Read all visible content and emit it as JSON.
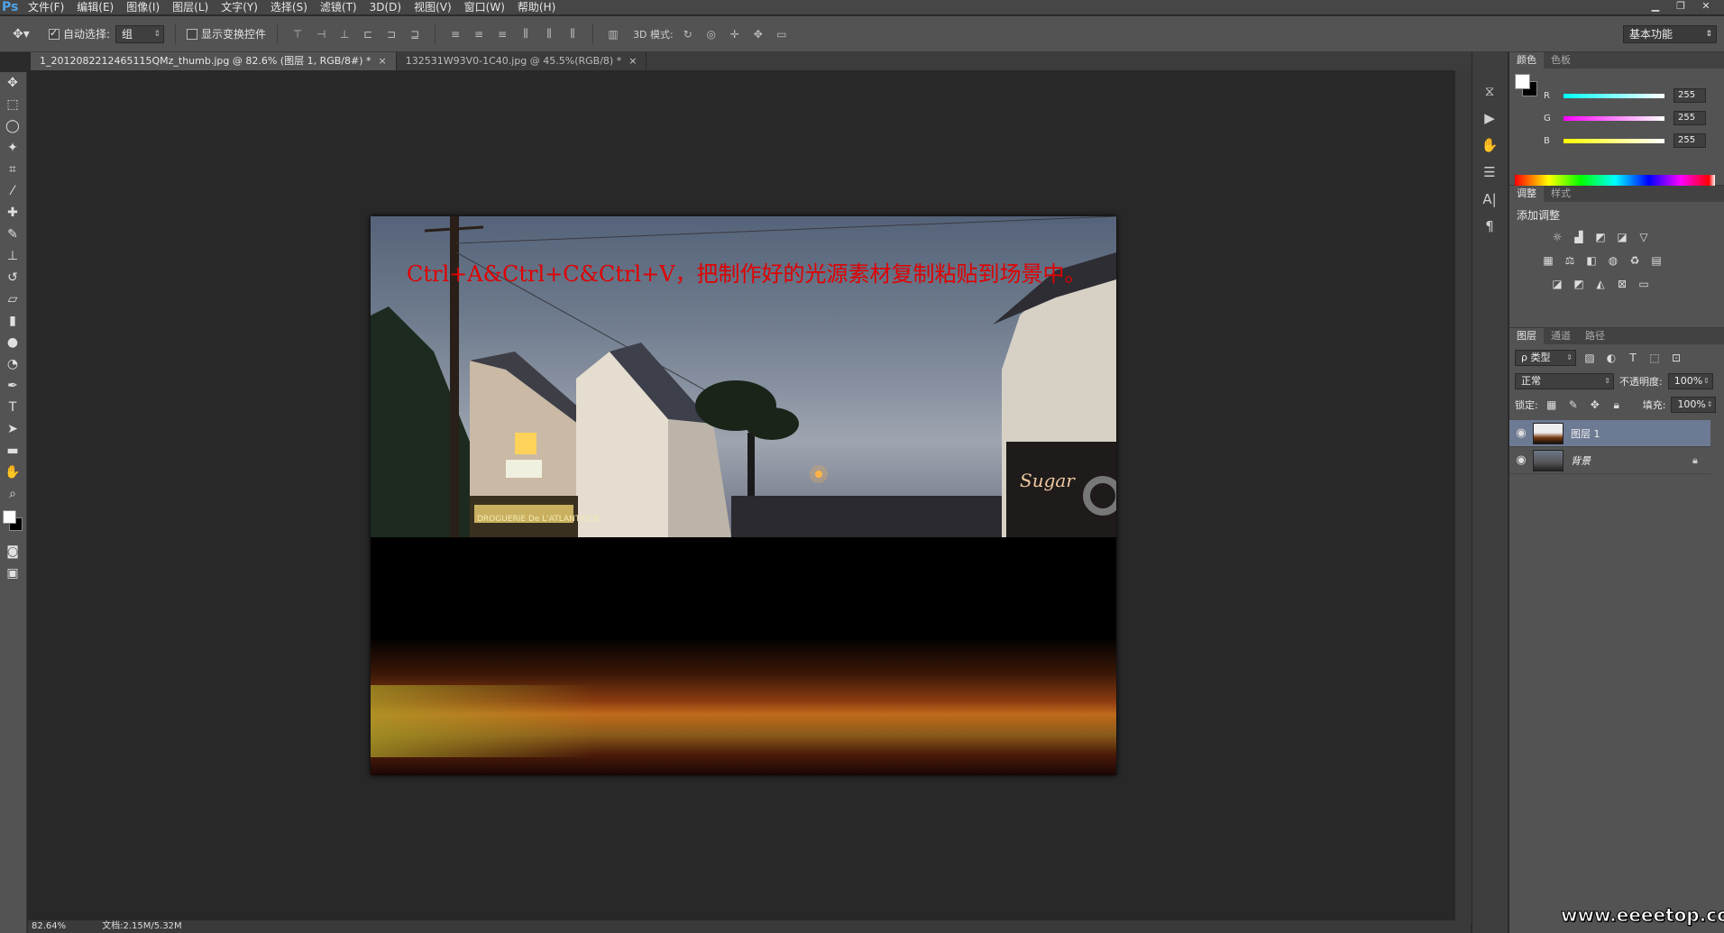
{
  "app": {
    "logo": "Ps"
  },
  "menu": [
    "文件(F)",
    "编辑(E)",
    "图像(I)",
    "图层(L)",
    "文字(Y)",
    "选择(S)",
    "滤镜(T)",
    "3D(D)",
    "视图(V)",
    "窗口(W)",
    "帮助(H)"
  ],
  "options": {
    "auto_select_label": "自动选择:",
    "auto_select_value": "组",
    "show_transform_label": "显示变换控件",
    "mode_label": "3D 模式:",
    "workspace": "基本功能"
  },
  "tabs": [
    {
      "label": "1_2012082212465115QMz_thumb.jpg @ 82.6% (图层 1, RGB/8#) *",
      "close": "×"
    },
    {
      "label": "132531W93V0-1C40.jpg @ 45.5%(RGB/8) *",
      "close": "×"
    }
  ],
  "canvas": {
    "caption": "Ctrl+A&Ctrl+C&Ctrl+V，把制作好的光源素材复制粘贴到场景中。",
    "sign_text": "Sugar",
    "shop_text": "DROGUERIE De L'ATLANTIQUE"
  },
  "status": {
    "zoom": "82.64%",
    "doc": "文档:2.15M/5.32M"
  },
  "color_panel": {
    "tabs": [
      "颜色",
      "色板"
    ],
    "r_label": "R",
    "g_label": "G",
    "b_label": "B",
    "r": "255",
    "g": "255",
    "b": "255"
  },
  "adjust_panel": {
    "tabs": [
      "调整",
      "样式"
    ],
    "title": "添加调整"
  },
  "layers_panel": {
    "tabs": [
      "图层",
      "通道",
      "路径"
    ],
    "filter": "ρ 类型",
    "blend": "正常",
    "opacity_label": "不透明度:",
    "opacity": "100%",
    "lock_label": "锁定:",
    "fill_label": "填充:",
    "fill": "100%",
    "layers": [
      {
        "name": "图层 1",
        "selected": true
      },
      {
        "name": "背景",
        "selected": false
      }
    ]
  },
  "watermark": "www.eeeetop.com",
  "colors": {
    "caption": "#e00000",
    "selected_layer": "#6d7a93",
    "app_bg": "#535353"
  }
}
